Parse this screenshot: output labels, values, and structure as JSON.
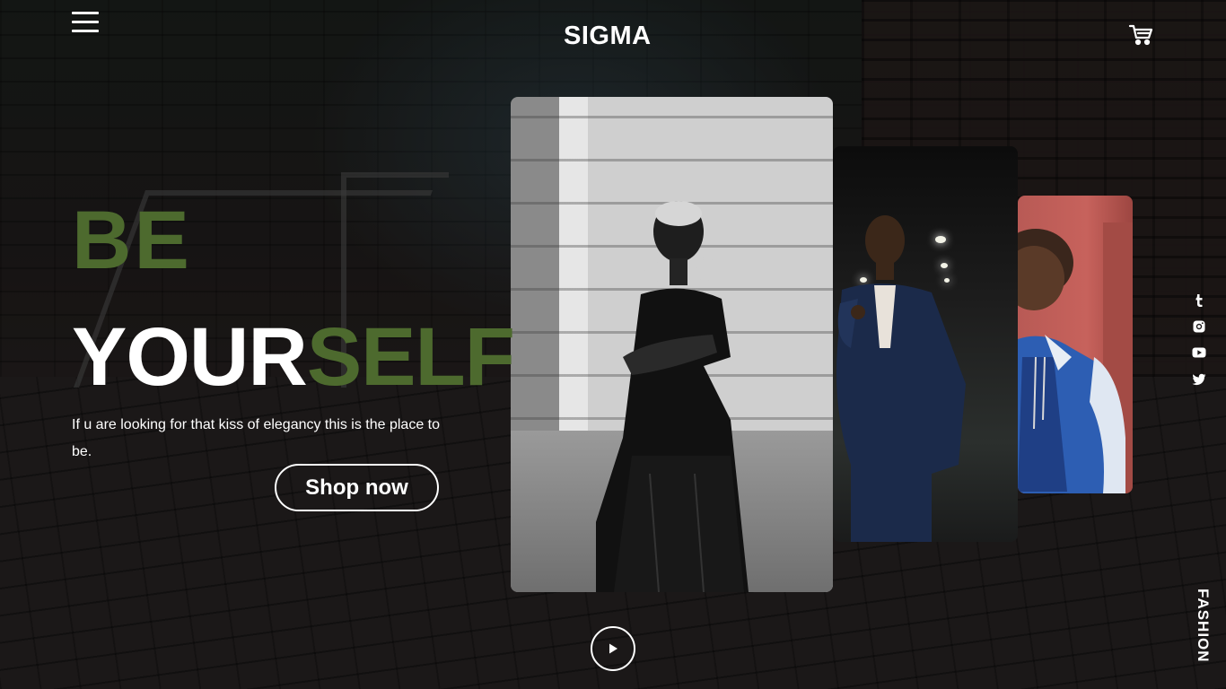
{
  "header": {
    "logo": "SIGMA",
    "menu_icon": "hamburger-menu-icon",
    "cart_icon": "cart-icon"
  },
  "hero": {
    "line1": "BE",
    "line2_white": "YOUR",
    "line2_green": "SELF",
    "tagline": "If u are looking for that kiss of elegancy this is the place to be.",
    "cta_label": "Shop now",
    "play_icon": "play-icon"
  },
  "social": [
    {
      "name": "tumblr",
      "icon": "tumblr-icon"
    },
    {
      "name": "instagram",
      "icon": "instagram-icon"
    },
    {
      "name": "youtube",
      "icon": "youtube-icon"
    },
    {
      "name": "twitter",
      "icon": "twitter-icon"
    }
  ],
  "side_label": "FASHION",
  "colors": {
    "accent_green": "#4d6a2e",
    "text": "#ffffff",
    "background": "#1a1716"
  }
}
